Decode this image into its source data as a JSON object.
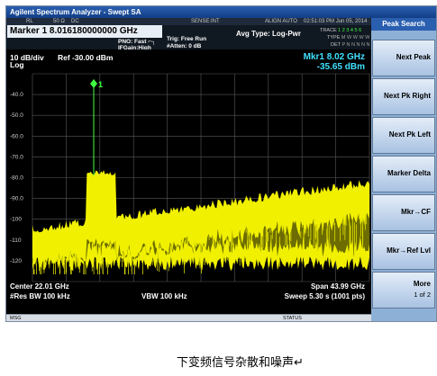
{
  "window": {
    "title": "Agilent Spectrum Analyzer - Swept SA"
  },
  "infostrip": {
    "rl": "RL",
    "ohms": "50 Ω",
    "dc": "DC",
    "sense": "SENSE:INT",
    "align": "ALIGN AUTO",
    "datetime": "02:51:03 PM Jun 05, 2014"
  },
  "header": {
    "marker_title": "Marker 1 8.016180000000 GHz",
    "pno": "PNO: Fast ⌐┐",
    "ifgain": "IFGain:High",
    "trig": "Trig: Free Run",
    "atten": "#Atten: 0 dB",
    "avg_type": "Avg Type: Log-Pwr",
    "trace_label": "TRACE",
    "type_label": "TYPE",
    "det_label": "DET",
    "trace_digits": "1 2 3 4 5 6",
    "type_letters": "M W W W W W",
    "det_letters": "P N N N N N"
  },
  "plot": {
    "scale": "10 dB/div",
    "log": "Log",
    "ref": "Ref -30.00 dBm",
    "mkr_freq": "Mkr1 8.02 GHz",
    "mkr_amp": "-35.65 dBm",
    "marker_label": "1",
    "y_ticks": [
      "-40.0",
      "-50.0",
      "-60.0",
      "-70.0",
      "-80.0",
      "-90.0",
      "-100",
      "-110",
      "-120"
    ],
    "center": "Center 22.01 GHz",
    "res_bw": "#Res BW 100 kHz",
    "vbw": "VBW 100 kHz",
    "span": "Span 43.99 GHz",
    "sweep": "Sweep  5.30 s (1001 pts)"
  },
  "status": {
    "msg": "MSG",
    "status": "STATUS"
  },
  "softkeys": {
    "title": "Peak Search",
    "items": [
      "Next Peak",
      "Next Pk Right",
      "Next Pk Left",
      "Marker Delta",
      "Mkr→CF",
      "Mkr→Ref Lvl",
      "More"
    ],
    "more_sub": "1 of 2"
  },
  "colors": {
    "trace": "#f0f000",
    "marker": "#40ff40",
    "grid": "#5a5a5a",
    "mkr_readout": "#40e0ff"
  },
  "caption": "下变频信号杂散和噪声↵"
}
